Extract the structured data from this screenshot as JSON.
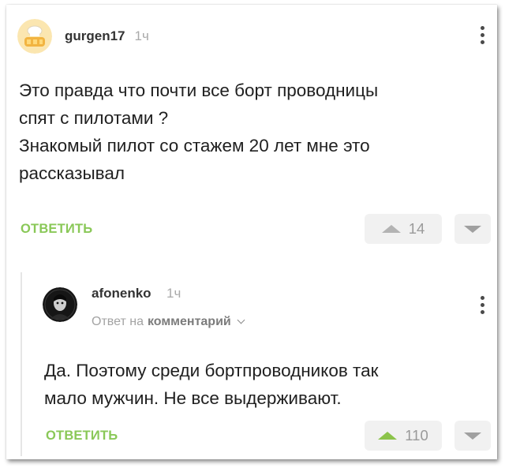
{
  "comment": {
    "avatar_icon": "chef-bread-icon",
    "username": "gurgen17",
    "time": "1ч",
    "text_lines": [
      "Это правда что почти все борт проводницы",
      "спят с пилотами ?",
      "Знакомый пилот со стажем 20 лет мне это",
      "рассказывал"
    ],
    "reply_label": "ОТВЕТИТЬ",
    "votes": "14"
  },
  "reply": {
    "avatar_icon": "dark-portrait-icon",
    "username": "afonenko",
    "time": "1ч",
    "reply_to_prefix": "Ответ на",
    "reply_to_target": "комментарий",
    "text_lines": [
      "Да. Поэтому среди бортпроводников так",
      "мало мужчин. Не все выдерживают."
    ],
    "reply_label": "ОТВЕТИТЬ",
    "votes": "110"
  },
  "colors": {
    "accent_green": "#8ac858",
    "upvote_active": "#8bc34a"
  }
}
